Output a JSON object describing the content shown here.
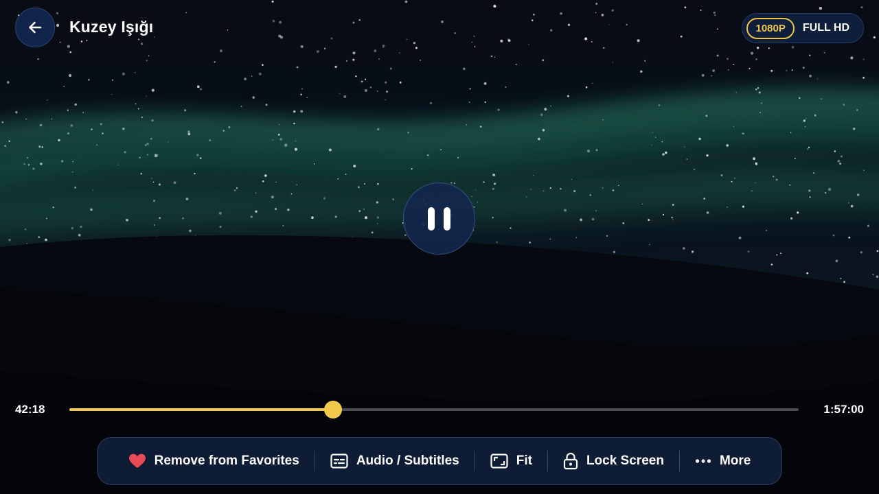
{
  "header": {
    "title": "Kuzey Işığı",
    "back_icon": "arrow-left-icon",
    "quality_badge": "1080P",
    "quality_label": "FULL HD"
  },
  "player": {
    "state_icon": "pause-icon",
    "elapsed": "42:18",
    "total": "1:57:00",
    "progress_fraction": 0.3615
  },
  "toolbar": {
    "favorite_label": "Remove from Favorites",
    "favorite_icon": "heart-icon",
    "audio_label": "Audio / Subtitles",
    "audio_icon": "subtitles-icon",
    "fit_label": "Fit",
    "fit_icon": "aspect-ratio-icon",
    "lock_label": "Lock Screen",
    "lock_icon": "lock-icon",
    "more_label": "More",
    "more_icon": "more-dots-icon"
  },
  "colors": {
    "accent": "#f2c94c",
    "favorite": "#e84b55",
    "panel": "#0e1c36",
    "aurora": "#2c8a6c"
  }
}
